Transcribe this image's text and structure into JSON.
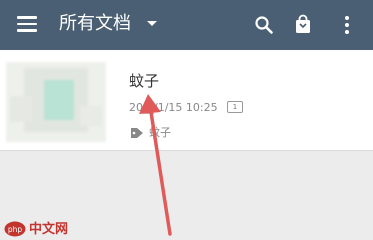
{
  "header": {
    "title": "所有文档",
    "menu_icon": "hamburger-menu-icon",
    "dropdown_icon": "caret-down-icon",
    "actions": [
      "search-icon",
      "bag-icon",
      "more-vertical-icon"
    ],
    "background": "#4a5f73"
  },
  "document": {
    "title": "蚊子",
    "date": "20__/1/15 10:25",
    "badge": "1",
    "tag": "蚊子"
  },
  "annotation_color": "#e05a5a",
  "watermark": {
    "logo_text": "php",
    "text": "中文网"
  }
}
